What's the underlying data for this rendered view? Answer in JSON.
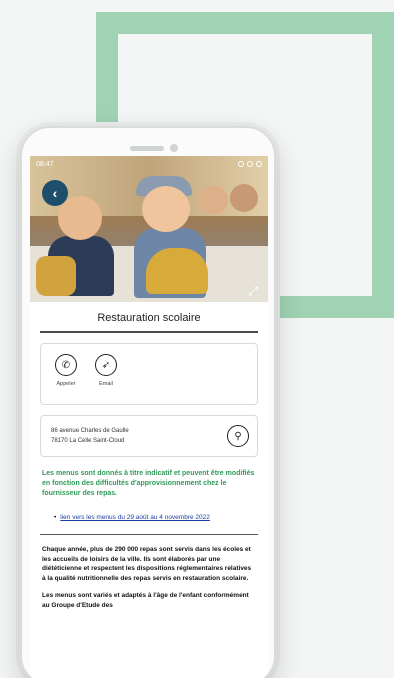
{
  "statusbar": {
    "time": "08:47"
  },
  "page": {
    "title": "Restauration scolaire"
  },
  "contact": {
    "call_label": "Appeler",
    "email_label": "Email"
  },
  "address": {
    "line1": "86 avenue Charles de Gaulle",
    "line2": "78170 La Celle Saint-Cloud"
  },
  "notice": "Les menus sont donnés à titre indicatif et peuvent être modifiés en fonction des difficultés d'approvisionnement chez le fournisseur des repas.",
  "menu_link": "lien vers les menus du 29 août au 4 novembre 2022",
  "paragraphs": [
    "Chaque année, plus de 290 000 repas sont servis dans les écoles et les accueils de loisirs de la ville. Ils sont élaborés par une diététicienne et respectent les dispositions réglementaires relatives à la qualité nutritionnelle des repas servis en restauration scolaire.",
    "Les menus sont variés et adaptés à l'âge de l'enfant conformément au Groupe d'Etude des"
  ],
  "colors": {
    "accent_green": "#2e9a5a",
    "frame_green": "#9fd3b4",
    "back_button": "#1d4f6b",
    "link": "#1b3fa0"
  },
  "icons": [
    "back-arrow-icon",
    "expand-icon",
    "phone-icon",
    "send-icon",
    "location-pin-icon"
  ]
}
